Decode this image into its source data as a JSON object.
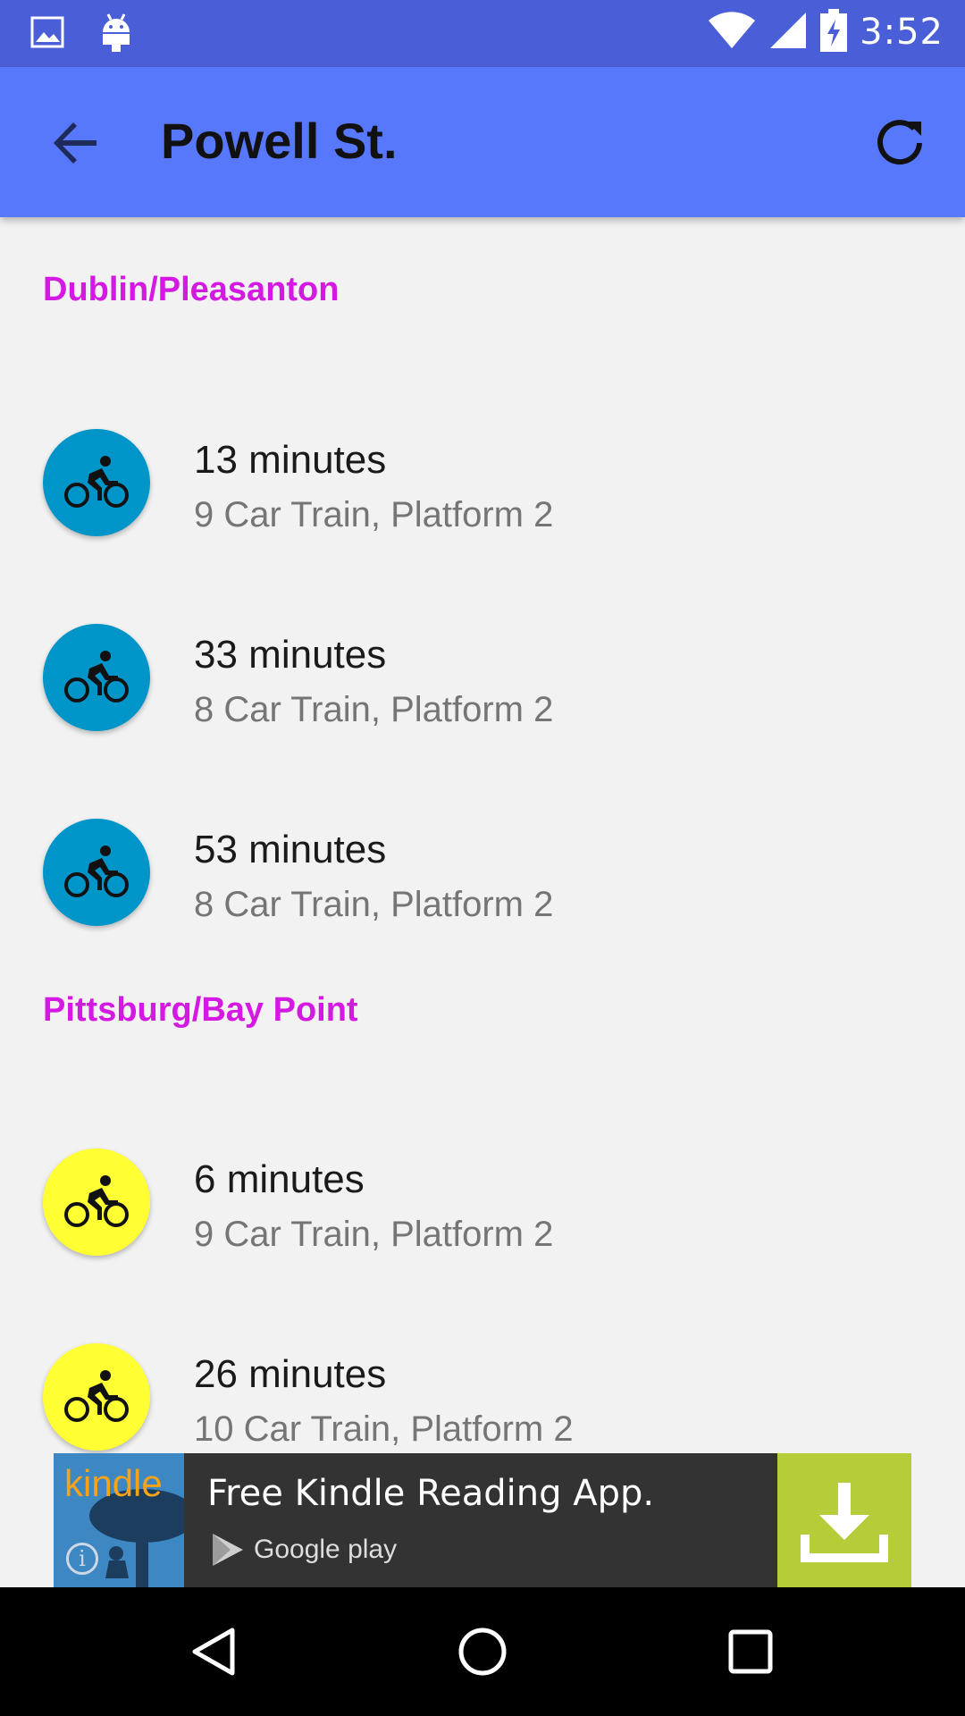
{
  "status_bar": {
    "time": "3:52",
    "left_icons": [
      "image-icon",
      "android-icon"
    ],
    "right_icons": [
      "wifi-icon",
      "signal-icon",
      "battery-charging-icon"
    ]
  },
  "app_bar": {
    "title": "Powell St.",
    "back_icon": "arrow-back-icon",
    "refresh_icon": "refresh-icon"
  },
  "sections": [
    {
      "header": "Dublin/Pleasanton",
      "color": "#0095c8",
      "trains": [
        {
          "minutes": "13 minutes",
          "details": "9 Car Train, Platform 2",
          "icon": "bike-icon"
        },
        {
          "minutes": "33 minutes",
          "details": "8 Car Train, Platform 2",
          "icon": "bike-icon"
        },
        {
          "minutes": "53 minutes",
          "details": "8 Car Train, Platform 2",
          "icon": "bike-icon"
        }
      ]
    },
    {
      "header": "Pittsburg/Bay Point",
      "color": "#ffff33",
      "trains": [
        {
          "minutes": "6 minutes",
          "details": "9 Car Train, Platform 2",
          "icon": "bike-icon"
        },
        {
          "minutes": "26 minutes",
          "details": "10 Car Train, Platform 2",
          "icon": "bike-icon"
        }
      ]
    }
  ],
  "ad": {
    "brand": "kindle",
    "headline": "Free Kindle Reading App.",
    "store": "Google play",
    "download_icon": "download-icon",
    "info_icon": "info-icon"
  },
  "nav": {
    "back": "nav-back-icon",
    "home": "nav-home-icon",
    "recents": "nav-recents-icon"
  },
  "colors": {
    "status_bar": "#4a5ed8",
    "app_bar": "#5878fb",
    "section_header": "#d319e2",
    "background": "#f2f2f2"
  }
}
